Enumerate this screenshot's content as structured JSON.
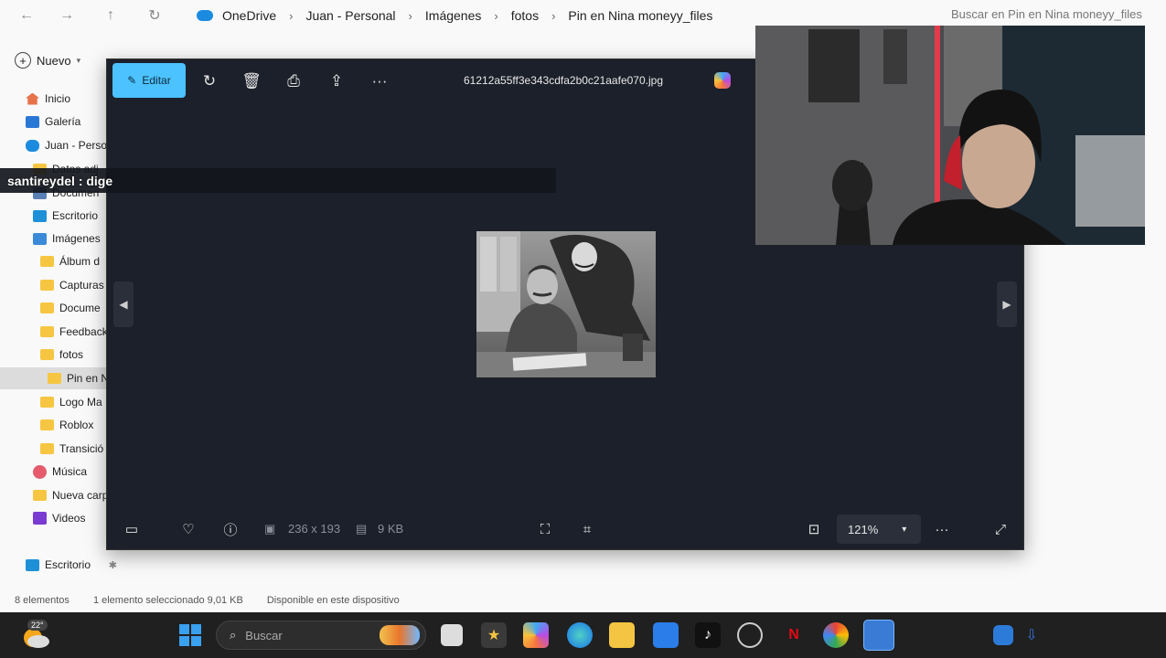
{
  "explorer": {
    "breadcrumbs": [
      "OneDrive",
      "Juan - Personal",
      "Imágenes",
      "fotos",
      "Pin en Nina moneyy_files"
    ],
    "search_placeholder": "Buscar en Pin en Nina moneyy_files",
    "new_label": "Nuevo",
    "sidebar": [
      {
        "label": "Inicio",
        "icon": "home-icon"
      },
      {
        "label": "Galería",
        "icon": "gallery-icon"
      },
      {
        "label": "Juan - Perso",
        "icon": "onedrive-icon"
      },
      {
        "label": "Datos adj",
        "icon": "folder-icon"
      },
      {
        "label": "Documen",
        "icon": "documents-icon"
      },
      {
        "label": "Escritorio",
        "icon": "desktop-icon"
      },
      {
        "label": "Imágenes",
        "icon": "pictures-icon"
      },
      {
        "label": "Álbum d",
        "icon": "folder-icon"
      },
      {
        "label": "Capturas",
        "icon": "folder-icon"
      },
      {
        "label": "Docume",
        "icon": "folder-icon"
      },
      {
        "label": "Feedback",
        "icon": "folder-icon"
      },
      {
        "label": "fotos",
        "icon": "folder-icon"
      },
      {
        "label": "Pin en N",
        "icon": "folder-icon",
        "selected": true
      },
      {
        "label": "Logo Ma",
        "icon": "folder-icon"
      },
      {
        "label": "Roblox",
        "icon": "folder-icon"
      },
      {
        "label": "Transició",
        "icon": "folder-icon"
      },
      {
        "label": "Música",
        "icon": "music-icon"
      },
      {
        "label": "Nueva carp",
        "icon": "folder-icon"
      },
      {
        "label": "Videos",
        "icon": "videos-icon"
      },
      {
        "label": "Escritorio",
        "icon": "desktop-icon"
      }
    ],
    "status": {
      "count": "8 elementos",
      "selected": "1 elemento seleccionado  9,01 KB",
      "availability": "Disponible en este dispositivo"
    }
  },
  "viewer": {
    "edit_label": "Editar",
    "filename": "61212a55ff3e343cdfa2b0c21aafe070.jpg",
    "dimensions": "236 x 193",
    "size": "9 KB",
    "zoom": "121%"
  },
  "chat": {
    "text": "santireydel : dige"
  },
  "taskbar": {
    "search_label": "Buscar",
    "temperature": "22°"
  },
  "colors": {
    "accent": "#4cc2ff",
    "viewer_bg": "#1c202a",
    "taskbar_bg": "#202020"
  }
}
